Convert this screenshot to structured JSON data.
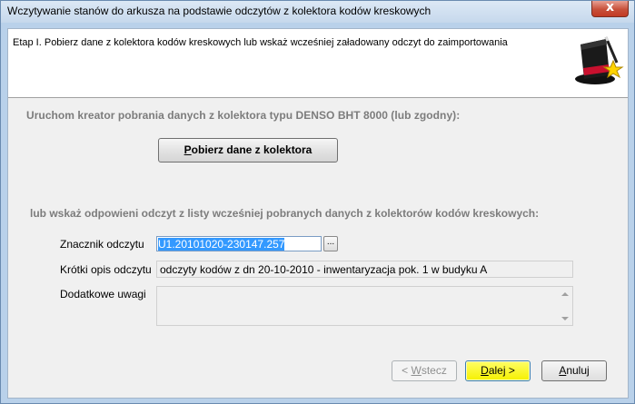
{
  "window": {
    "title": "Wczytywanie stanów do arkusza na podstawie odczytów z kolektora kodów kreskowych",
    "close_label": "x"
  },
  "header": {
    "step_text": "Etap I.  Pobierz dane z kolektora kodów kreskowych lub wskaż wcześniej załadowany odczyt do zaimportowania",
    "icon": "magic-hat-icon"
  },
  "section1": {
    "label": "Uruchom kreator pobrania danych z kolektora typu DENSO BHT 8000 (lub zgodny):",
    "button_first": "P",
    "button_rest": "obierz dane z kolektora"
  },
  "section2": {
    "label": "lub wskaż odpowieni odczyt z listy wcześniej pobranych danych z kolektorów kodów kreskowych:"
  },
  "form": {
    "marker_label": "Znacznik odczytu",
    "marker_value": "U1.20101020-230147.257",
    "ellipsis_label": "...",
    "desc_label": "Krótki opis odczytu",
    "desc_value": "odczyty kodów z dn 20-10-2010 - inwentaryzacja pok. 1 w budyku A",
    "notes_label": "Dodatkowe uwagi",
    "notes_value": ""
  },
  "buttons": {
    "back_prefix": "< ",
    "back_key": "W",
    "back_rest": "stecz",
    "next_key": "D",
    "next_rest": "alej >",
    "cancel_key": "A",
    "cancel_rest": "nuluj"
  }
}
